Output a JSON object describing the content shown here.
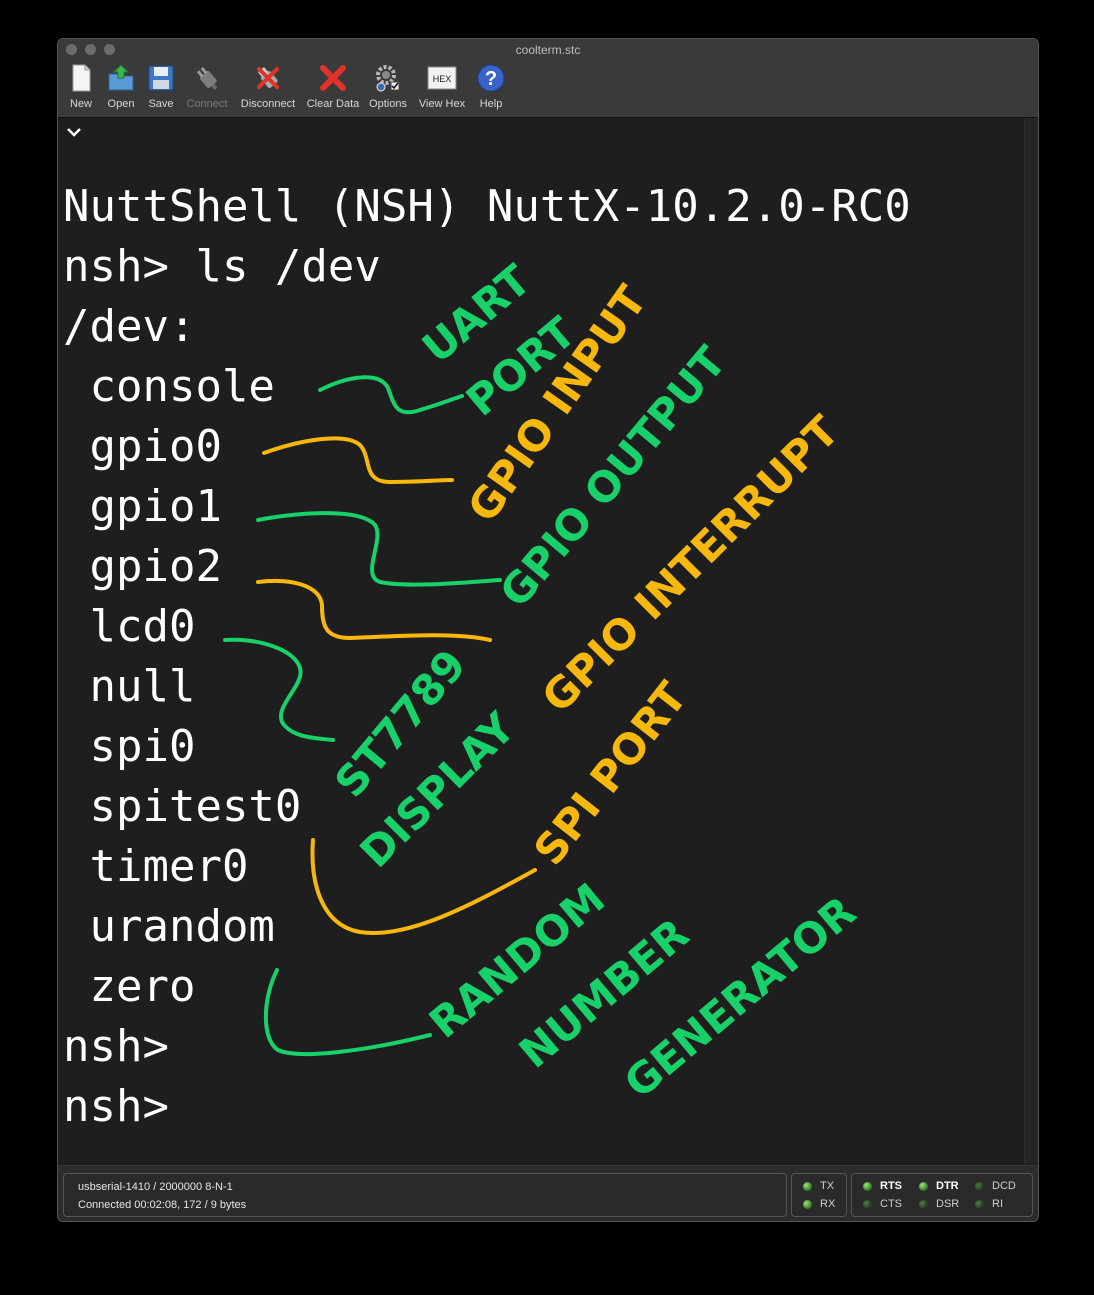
{
  "window": {
    "title": "coolterm.stc"
  },
  "toolbar": {
    "new": "New",
    "open": "Open",
    "save": "Save",
    "connect": "Connect",
    "disconnect": "Disconnect",
    "clear_data": "Clear Data",
    "options": "Options",
    "view_hex": "View Hex",
    "view_hex_icon_text": "HEX",
    "help": "Help"
  },
  "terminal": {
    "lines": [
      "NuttShell (NSH) NuttX-10.2.0-RC0",
      "nsh> ls /dev",
      "/dev:",
      " console",
      " gpio0",
      " gpio1",
      " gpio2",
      " lcd0",
      " null",
      " spi0",
      " spitest0",
      " timer0",
      " urandom",
      " zero",
      "nsh>",
      "nsh>"
    ]
  },
  "annotations": {
    "colors": {
      "green": "#19d16a",
      "yellow": "#f7b80e"
    },
    "uart_1": "UART",
    "uart_2": "PORT",
    "gpio_input": "GPIO INPUT",
    "gpio_output": "GPIO OUTPUT",
    "gpio_interrupt": "GPIO INTERRUPT",
    "st7789_1": "ST7789",
    "st7789_2": "DISPLAY",
    "spi_port": "SPI PORT",
    "rng_1": "RANDOM",
    "rng_2": "NUMBER",
    "rng_3": "GENERATOR"
  },
  "status": {
    "port_line": "usbserial-1410 / 2000000 8-N-1",
    "connected_line": "Connected 00:02:08, 172 / 9 bytes",
    "tx": "TX",
    "rx": "RX",
    "rts": "RTS",
    "cts": "CTS",
    "dtr": "DTR",
    "dsr": "DSR",
    "dcd": "DCD",
    "ri": "RI"
  }
}
